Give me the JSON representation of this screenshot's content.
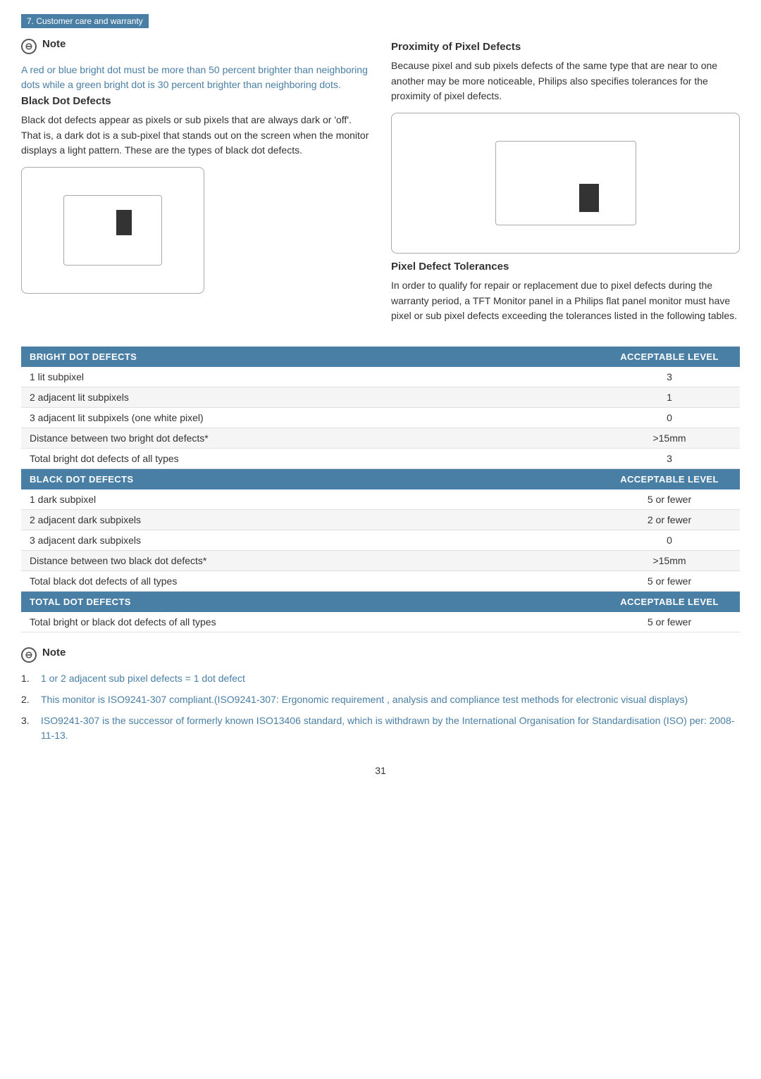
{
  "topBar": {
    "label": "7. Customer care and warranty"
  },
  "noteBlock": {
    "icon": "⊖",
    "label": "Note",
    "text": "A red or blue bright dot must be more than 50 percent brighter than neighboring dots while a green bright dot is 30 percent brighter than neighboring dots."
  },
  "blackDotSection": {
    "heading": "Black Dot Defects",
    "body": "Black dot defects appear as pixels or sub pixels that are always dark or 'off'. That is, a dark dot is a sub-pixel that stands out on the screen when the monitor displays a light pattern. These are the types of black dot defects."
  },
  "proximitySection": {
    "heading": "Proximity of Pixel Defects",
    "body": "Because pixel and sub pixels defects of the same type that are near to one another may be more noticeable, Philips also specifies tolerances for the proximity of pixel defects."
  },
  "pixelDefectSection": {
    "heading": "Pixel Defect Tolerances",
    "body": "In order to qualify for repair or replacement due to pixel defects during the warranty period, a TFT Monitor panel in a Philips flat panel monitor must have pixel or sub pixel defects exceeding the tolerances listed in the following tables."
  },
  "table": {
    "sections": [
      {
        "header": "BRIGHT DOT DEFECTS",
        "headerRight": "ACCEPTABLE LEVEL",
        "rows": [
          {
            "label": "1 lit subpixel",
            "value": "3"
          },
          {
            "label": "2 adjacent lit subpixels",
            "value": "1"
          },
          {
            "label": "3 adjacent lit subpixels (one white pixel)",
            "value": "0"
          },
          {
            "label": "Distance between two bright dot defects*",
            "value": ">15mm"
          },
          {
            "label": "Total bright dot defects of all types",
            "value": "3"
          }
        ]
      },
      {
        "header": "BLACK DOT DEFECTS",
        "headerRight": "ACCEPTABLE LEVEL",
        "rows": [
          {
            "label": "1 dark subpixel",
            "value": "5 or fewer"
          },
          {
            "label": "2 adjacent dark subpixels",
            "value": "2 or fewer"
          },
          {
            "label": "3 adjacent dark subpixels",
            "value": "0"
          },
          {
            "label": "Distance between two black dot defects*",
            "value": ">15mm"
          },
          {
            "label": "Total black dot defects of all types",
            "value": "5 or fewer"
          }
        ]
      },
      {
        "header": "TOTAL DOT DEFECTS",
        "headerRight": "ACCEPTABLE LEVEL",
        "rows": [
          {
            "label": "Total bright or black dot defects of all types",
            "value": "5 or fewer"
          }
        ]
      }
    ]
  },
  "noteBottom": {
    "icon": "⊖",
    "label": "Note",
    "items": [
      {
        "num": "1.",
        "text": "1 or 2 adjacent sub pixel defects = 1 dot defect"
      },
      {
        "num": "2.",
        "text": "This monitor is ISO9241-307 compliant.(ISO9241-307: Ergonomic requirement , analysis and compliance test methods for electronic visual displays)"
      },
      {
        "num": "3.",
        "text": "ISO9241-307 is the successor of formerly known ISO13406 standard, which is withdrawn by the International Organisation for Standardisation (ISO) per: 2008-11-13."
      }
    ]
  },
  "pageNumber": "31"
}
